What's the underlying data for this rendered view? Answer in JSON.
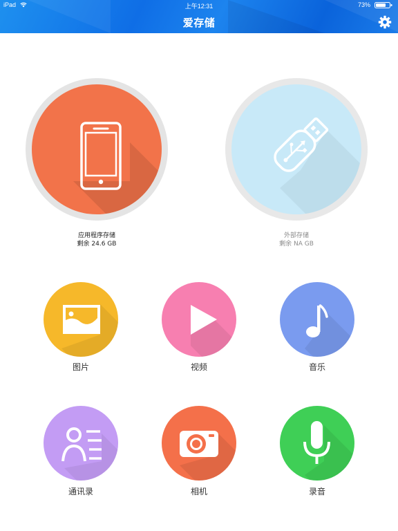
{
  "status_bar": {
    "carrier": "iPad",
    "time": "上午12:31",
    "battery": "73%"
  },
  "header": {
    "title": "爱存储",
    "settings_icon": "gear-icon"
  },
  "storage": [
    {
      "name": "应用程序存储",
      "remaining": "剩余 24.6 GB",
      "icon": "tablet-icon",
      "color": "#f2734a"
    },
    {
      "name": "外部存储",
      "remaining": "剩余 NA GB",
      "icon": "usb-drive-icon",
      "color": "#c8e9f8"
    }
  ],
  "categories": [
    {
      "label": "图片",
      "icon": "picture-icon",
      "color": "#f6b82a"
    },
    {
      "label": "视频",
      "icon": "play-icon",
      "color": "#f77fb0"
    },
    {
      "label": "音乐",
      "icon": "music-note-icon",
      "color": "#7a9bef"
    },
    {
      "label": "通讯录",
      "icon": "contacts-icon",
      "color": "#c39cf4"
    },
    {
      "label": "相机",
      "icon": "camera-icon",
      "color": "#f4704a"
    },
    {
      "label": "录音",
      "icon": "microphone-icon",
      "color": "#3fcf56"
    }
  ]
}
